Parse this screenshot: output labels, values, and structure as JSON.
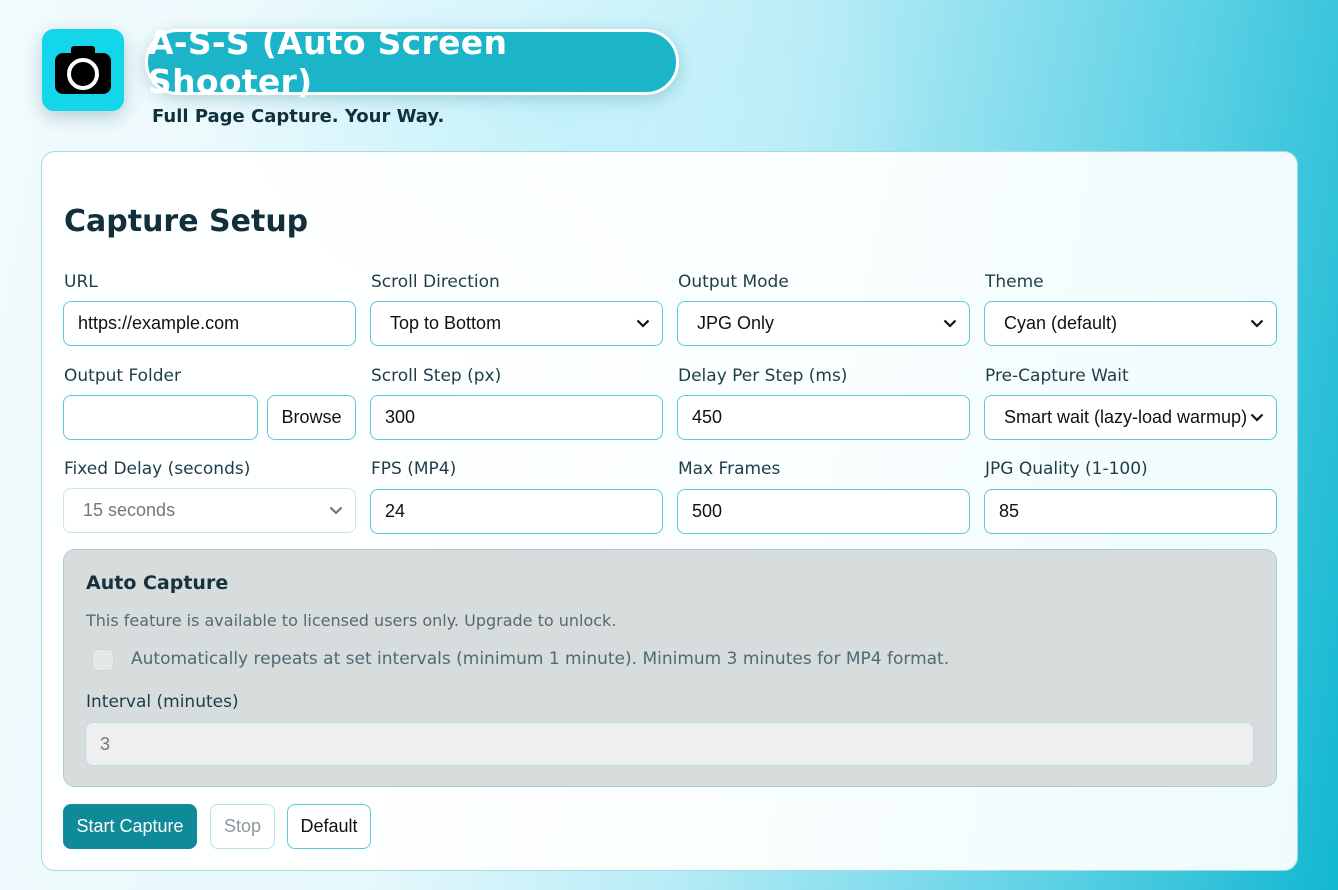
{
  "header": {
    "app_icon": "camera-icon",
    "title": "A-S-S (Auto Screen Shooter)",
    "tagline": "Full Page Capture. Your Way."
  },
  "setup": {
    "title": "Capture Setup",
    "url": {
      "label": "URL",
      "value": "https://example.com"
    },
    "scroll_direction": {
      "label": "Scroll Direction",
      "value": "Top to Bottom"
    },
    "output_mode": {
      "label": "Output Mode",
      "value": "JPG Only"
    },
    "theme": {
      "label": "Theme",
      "value": "Cyan (default)"
    },
    "output_folder": {
      "label": "Output Folder",
      "value": "",
      "browse_label": "Browse"
    },
    "scroll_step": {
      "label": "Scroll Step (px)",
      "value": "300"
    },
    "delay_per_step": {
      "label": "Delay Per Step (ms)",
      "value": "450"
    },
    "pre_capture_wait": {
      "label": "Pre-Capture Wait",
      "value": "Smart wait (lazy-load warmup)"
    },
    "fixed_delay": {
      "label": "Fixed Delay (seconds)",
      "value": "15 seconds"
    },
    "fps": {
      "label": "FPS (MP4)",
      "value": "24"
    },
    "max_frames": {
      "label": "Max Frames",
      "value": "500"
    },
    "jpg_quality": {
      "label": "JPG Quality (1-100)",
      "value": "85"
    }
  },
  "auto_capture": {
    "title": "Auto Capture",
    "note": "This feature is available to licensed users only. Upgrade to unlock.",
    "checkbox_label": "Automatically repeats at set intervals (minimum 1 minute). Minimum 3 minutes for MP4 format.",
    "checked": false,
    "interval_label": "Interval (minutes)",
    "interval_value": "3"
  },
  "actions": {
    "start_label": "Start Capture",
    "stop_label": "Stop",
    "default_label": "Default"
  },
  "colors": {
    "accent": "#1bb4c9",
    "primary_button": "#0f8a99",
    "input_border": "#5ec9d6"
  }
}
